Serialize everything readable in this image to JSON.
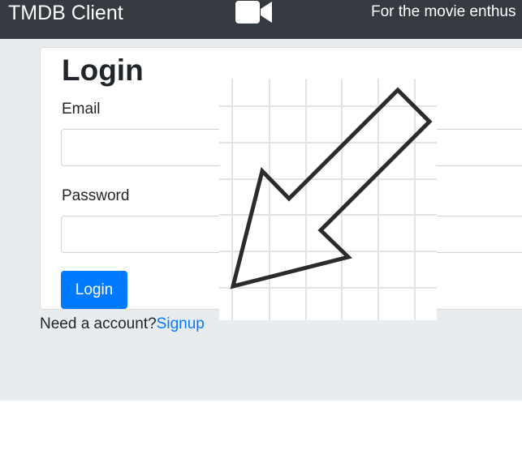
{
  "navbar": {
    "brand": "TMDB Client",
    "icon": "video-camera-icon",
    "tagline": "For the movie enthus"
  },
  "login": {
    "title": "Login",
    "email_label": "Email",
    "email_value": "",
    "password_label": "Password",
    "password_value": "",
    "submit_label": "Login"
  },
  "footer": {
    "prompt": "Need a account?",
    "signup_link": "Signup"
  },
  "overlay": {
    "icon": "arrow-down-left-icon"
  },
  "colors": {
    "navbar_bg": "#343a40",
    "page_bg": "#e9ecef",
    "primary": "#007bff"
  }
}
